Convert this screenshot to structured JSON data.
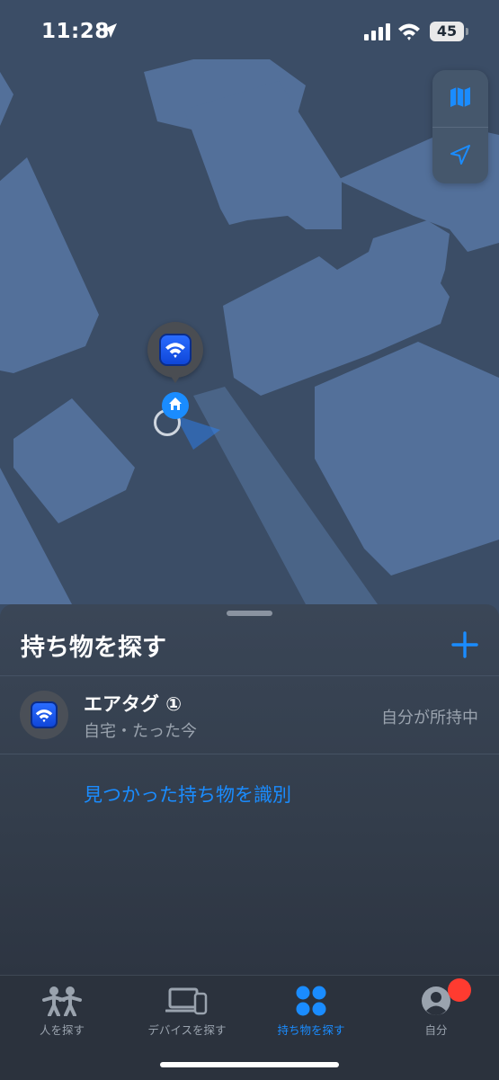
{
  "status_bar": {
    "time": "11:28",
    "battery": "45",
    "location_icon": "location-arrow-icon",
    "signal_icon": "cellular-signal-icon",
    "wifi_icon": "wifi-icon"
  },
  "map": {
    "controls": [
      {
        "icon": "map-icon"
      },
      {
        "icon": "location-arrow-icon"
      }
    ],
    "item_pin_icon": "wifi-icon",
    "home_pin_icon": "house-icon"
  },
  "sheet": {
    "title": "持ち物を探す",
    "add_icon": "plus-icon",
    "items": [
      {
        "name": "エアタグ ①",
        "subtitle": "自宅・たった今",
        "status": "自分が所持中",
        "icon": "wifi-icon"
      }
    ],
    "identify_link": "見つかった持ち物を識別"
  },
  "tab_bar": {
    "tabs": [
      {
        "label": "人を探す",
        "icon": "people-icon",
        "active": false
      },
      {
        "label": "デバイスを探す",
        "icon": "devices-icon",
        "active": false
      },
      {
        "label": "持ち物を探す",
        "icon": "items-icon",
        "active": true
      },
      {
        "label": "自分",
        "icon": "person-circle-icon",
        "active": false
      }
    ],
    "me_badge": true
  },
  "colors": {
    "accent": "#1a8cff",
    "map_background": "#3b4d66",
    "map_buildings": "#53709a",
    "sheet_background": "#353f4d",
    "badge": "#ff3b30"
  }
}
